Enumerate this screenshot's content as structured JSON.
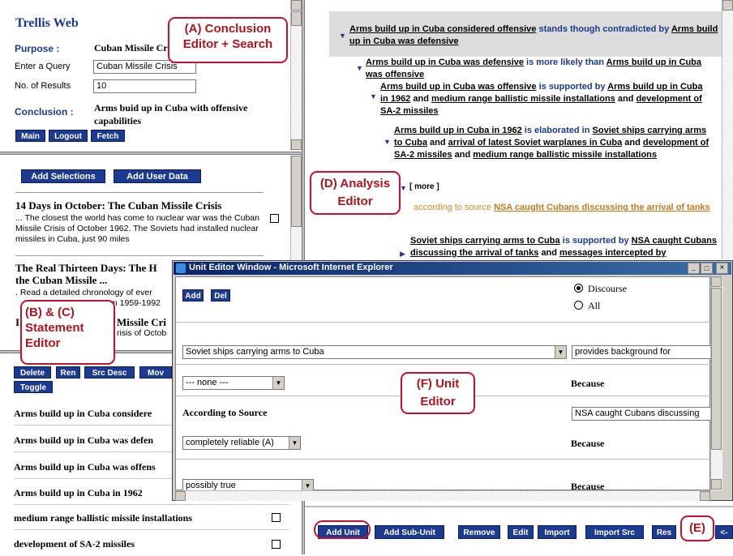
{
  "left_top": {
    "app_title": "Trellis Web",
    "purpose_label": "Purpose :",
    "purpose_value": "Cuban Missile Cr",
    "query_label": "Enter a Query",
    "query_value": "Cuban Missile Crisis",
    "results_label": "No. of Results",
    "results_value": "10",
    "conclusion_label": "Conclusion :",
    "conclusion_value": "Arms buid up in Cuba with offensive capabilities",
    "buttons": [
      "Main",
      "Logout",
      "Fetch"
    ]
  },
  "search": {
    "buttons": [
      "Add Selections",
      "Add User Data"
    ],
    "results": [
      {
        "title": "14 Days in October: The Cuban Missile Crisis",
        "snippet": "... The closest the world has come to nuclear war was the Cuban Missile Crisis of October 1962. The Soviets had installed nuclear missiles in Cuba, just 90 miles"
      },
      {
        "title": "The Real Thirteen Days: The H",
        "title2": "the Cuban Missile ...",
        "snippet1": ". Read a detailed chronology of ever",
        "snippet2": "m 1959-1992"
      },
      {
        "title": "Missile Cri",
        "snippet": "risis of Octob"
      }
    ],
    "title_prefix_3": "I"
  },
  "statement": {
    "buttons": [
      "Delete",
      "Ren",
      "Src Desc",
      "Mov",
      "Toggle"
    ],
    "items": [
      "Arms build up in Cuba considere",
      "Arms build up in Cuba was defen",
      "Arms build up in Cuba was offens",
      "Arms build up in Cuba in 1962",
      "medium range ballistic missile installations",
      "development of SA-2 missiles"
    ]
  },
  "analysis": {
    "header": {
      "a": "Arms build up in Cuba considered offensive",
      "rel": " stands though contradicted by ",
      "b": "Arms build up in Cuba was defensive"
    },
    "l1": {
      "a": "Arms build up in Cuba was defensive",
      "rel": " is more likely than ",
      "b": "Arms build up in Cuba was offensive"
    },
    "l2": {
      "a": "Arms build up in Cuba was offensive",
      "rel": " is supported by ",
      "b": "Arms build up in Cuba in 1962",
      "and1": " and ",
      "c": "medium range ballistic missile installations",
      "and2": " and ",
      "d": "development of SA-2 missiles"
    },
    "l3": {
      "a": "Arms build up in Cuba in 1962",
      "rel": " is elaborated in ",
      "b": "Soviet ships carrying arms to Cuba",
      "and1": " and ",
      "c": "arrival of latest Soviet warplanes in Cuba",
      "and2": " and ",
      "d": "development of SA-2 missiles",
      "and3": " and ",
      "e": "medium range ballistic missile installations"
    },
    "more": "[ more ]",
    "source_prefix": "according to source ",
    "source_link": "NSA caught Cubans discussing the arrival of tanks",
    "l4": {
      "a": "Soviet ships carrying arms to Cuba",
      "rel": " is supported by ",
      "b": "NSA caught Cubans discussing the arrival of tanks",
      "and1": " and ",
      "c": "messages intercepted by"
    }
  },
  "bottom_bar": {
    "buttons": [
      "Add Unit",
      "Add Sub-Unit",
      "Remove",
      "Edit",
      "Import",
      "Import Src",
      "Res",
      "<-"
    ]
  },
  "unit_editor": {
    "title": "Unit Editor Window - Microsoft Internet Explorer",
    "add": "Add",
    "del": "Del",
    "radio_discourse": "Discourse",
    "radio_all": "All",
    "statement_select": "Soviet ships carrying arms to Cuba",
    "relation_value": "provides background for",
    "none_select": "--- none ---",
    "because1": "Because",
    "according_label": "According to Source",
    "source_value": "NSA caught Cubans discussing",
    "reliability_select": "completely reliable (A)",
    "because2": "Because",
    "credibility_select": "possibly true",
    "because3": "Because"
  },
  "callouts": {
    "a": "(A) Conclusion Editor + Search",
    "d": "(D) Analysis Editor",
    "bc": "(B) & (C) Statement Editor",
    "f": "(F) Unit Editor",
    "e": "(E)"
  }
}
